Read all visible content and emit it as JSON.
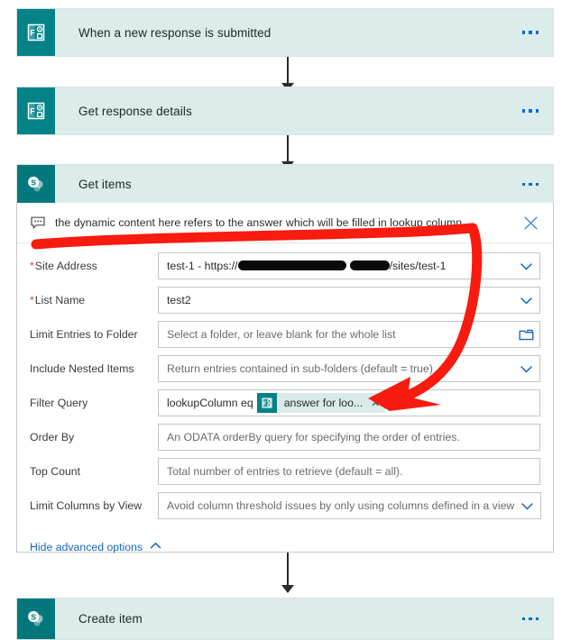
{
  "flow": {
    "steps": [
      {
        "id": "trigger",
        "title": "When a new response is submitted",
        "icon": "microsoft-forms-icon",
        "connector": true
      },
      {
        "id": "response",
        "title": "Get response details",
        "icon": "microsoft-forms-icon",
        "connector": true
      },
      {
        "id": "get-items",
        "title": "Get items",
        "icon": "sharepoint-icon",
        "connector": true
      },
      {
        "id": "create-item",
        "title": "Create item",
        "icon": "sharepoint-icon",
        "connector": false
      }
    ],
    "more_menu_label": "..."
  },
  "panel": {
    "comment": {
      "icon": "comment-bubble-icon",
      "text": "the dynamic content here refers to the answer which will be filled in lookup column",
      "close_label": "✕"
    },
    "fields": [
      {
        "id": "site-address",
        "label": "Site Address",
        "required": true,
        "value_prefix": "test-1 - https://",
        "value_suffix": "/sites/test-1",
        "redacted": true,
        "control": "dropdown"
      },
      {
        "id": "list-name",
        "label": "List Name",
        "required": true,
        "value": "test2",
        "control": "dropdown"
      },
      {
        "id": "limit-entries-to-folder",
        "label": "Limit Entries to Folder",
        "required": false,
        "placeholder": "Select a folder, or leave blank for the whole list",
        "control": "folder-picker"
      },
      {
        "id": "include-nested-items",
        "label": "Include Nested Items",
        "required": false,
        "placeholder": "Return entries contained in sub-folders (default = true)",
        "control": "dropdown"
      },
      {
        "id": "filter-query",
        "label": "Filter Query",
        "required": false,
        "value": "lookupColumn eq",
        "token": {
          "icon": "microsoft-forms-icon",
          "label": "answer for loo...",
          "remove_label": "✕"
        },
        "control": "text"
      },
      {
        "id": "order-by",
        "label": "Order By",
        "required": false,
        "placeholder": "An ODATA orderBy query for specifying the order of entries.",
        "control": "text"
      },
      {
        "id": "top-count",
        "label": "Top Count",
        "required": false,
        "placeholder": "Total number of entries to retrieve (default = all).",
        "control": "text"
      },
      {
        "id": "limit-columns-by-view",
        "label": "Limit Columns by View",
        "required": false,
        "placeholder": "Avoid column threshold issues by only using columns defined in a view",
        "control": "dropdown"
      }
    ],
    "advanced_toggle": {
      "label": "Hide advanced options",
      "icon": "chevron-up-icon"
    }
  },
  "annotation": {
    "color": "#f81b0f",
    "type": "hand-drawn-arrow",
    "description": "red arrow from comment text curving down to the dynamic content token in Filter Query"
  },
  "colors": {
    "card_background": "#dceceb",
    "forms_teal": "#038387",
    "sharepoint_teal": "#03787c",
    "link_blue": "#1569c0",
    "accent_blue": "#0b6bcb",
    "required_red": "#e03e3e",
    "annotation_red": "#f81b0f"
  }
}
